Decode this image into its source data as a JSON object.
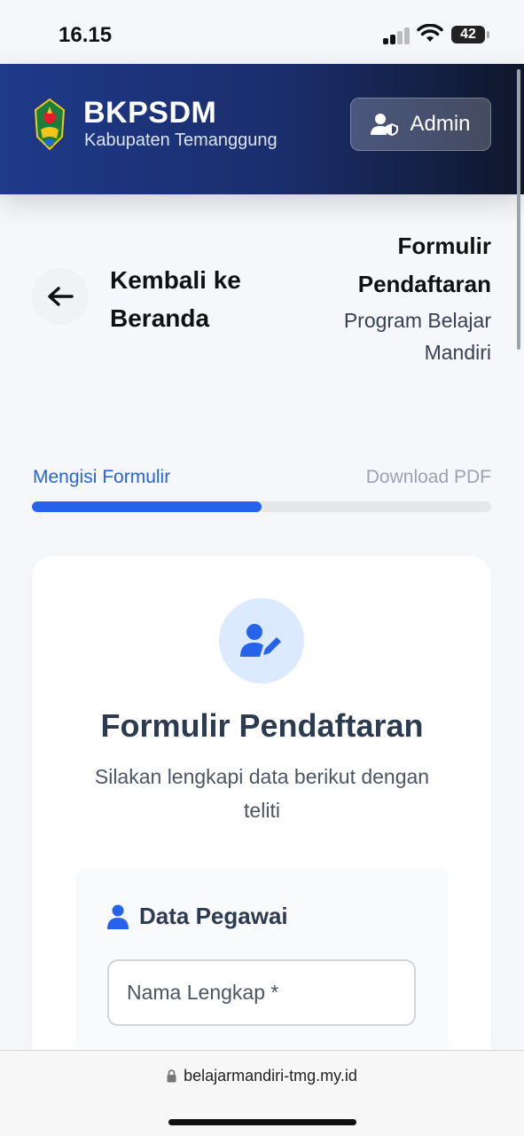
{
  "status": {
    "time": "16.15",
    "battery": "42"
  },
  "header": {
    "brand_title": "BKPSDM",
    "brand_sub": "Kabupaten Temanggung",
    "admin_label": "Admin"
  },
  "nav": {
    "back_label": "Kembali ke Beranda",
    "page_title": "Formulir Pendaftaran",
    "page_sub": "Program Belajar Mandiri"
  },
  "steps": {
    "active": "Mengisi Formulir",
    "next": "Download PDF",
    "progress_fraction": 0.5
  },
  "form": {
    "title": "Formulir Pendaftaran",
    "desc": "Silakan lengkapi data berikut dengan teliti",
    "section_title": "Data Pegawai",
    "name_placeholder": "Nama Lengkap *"
  },
  "browser": {
    "url": "belajarmandiri-tmg.my.id"
  },
  "colors": {
    "primary": "#2563eb",
    "header_start": "#1e3a8a",
    "header_end": "#0f172a"
  }
}
